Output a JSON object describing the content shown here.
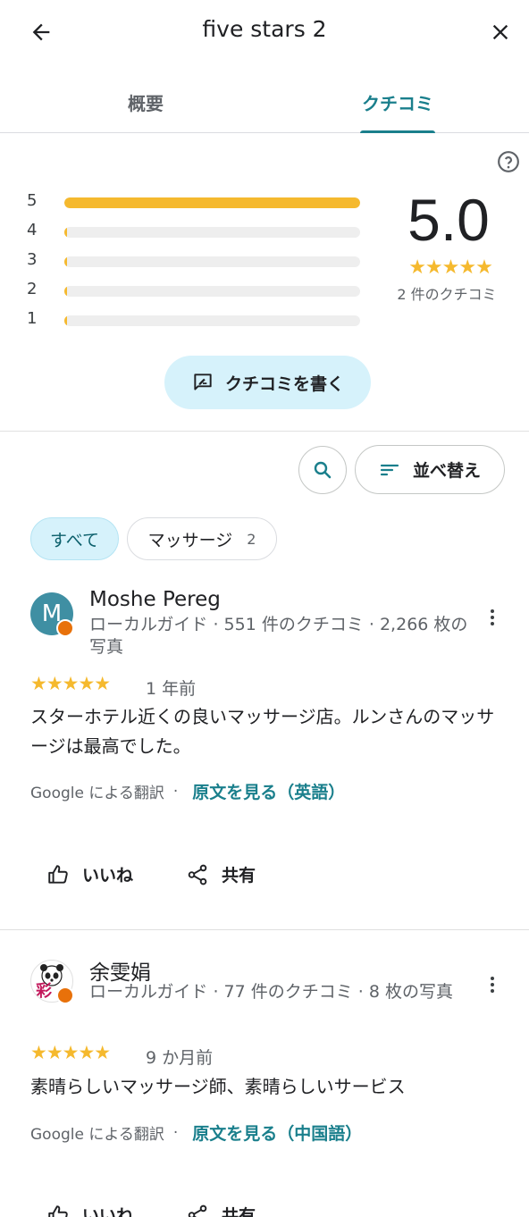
{
  "header": {
    "title": "five stars 2"
  },
  "tabs": [
    {
      "label": "概要"
    },
    {
      "label": "クチコミ"
    }
  ],
  "rating": {
    "score": "5.0",
    "stars": "★★★★★",
    "count_text": "2 件のクチコミ",
    "distribution": [
      {
        "star": "5",
        "fraction": 1.0
      },
      {
        "star": "4",
        "fraction": 0.0
      },
      {
        "star": "3",
        "fraction": 0.0
      },
      {
        "star": "2",
        "fraction": 0.0
      },
      {
        "star": "1",
        "fraction": 0.0
      }
    ]
  },
  "write_review": {
    "label": "クチコミを書く"
  },
  "sort": {
    "label": "並べ替え"
  },
  "chips": {
    "all": "すべて",
    "massage": "マッサージ",
    "massage_count": "2"
  },
  "reviews": [
    {
      "avatar_letter": "M",
      "name": "Moshe Pereg",
      "meta": "ローカルガイド · 551 件のクチコミ · 2,266 枚の写真",
      "stars": "★★★★★",
      "when": "1 年前",
      "text": "スターホテル近くの良いマッサージ店。ルンさんのマッサージは最高でした。",
      "translated_by": "Google による翻訳",
      "original_link": "原文を見る（英語）",
      "like": "いいね",
      "share": "共有"
    },
    {
      "avatar_letter": "彩",
      "name": "余雯娟",
      "meta": "ローカルガイド · 77 件のクチコミ · 8 枚の写真",
      "stars": "★★★★★",
      "when": "9 か月前",
      "text": "素晴らしいマッサージ師、素晴らしいサービス",
      "translated_by": "Google による翻訳",
      "original_link": "原文を見る（中国語）",
      "like": "いいね",
      "share": "共有"
    }
  ],
  "colors": {
    "accent": "#1a7f8c",
    "star": "#f5b92e",
    "chip_bg": "#d6f2fb"
  }
}
